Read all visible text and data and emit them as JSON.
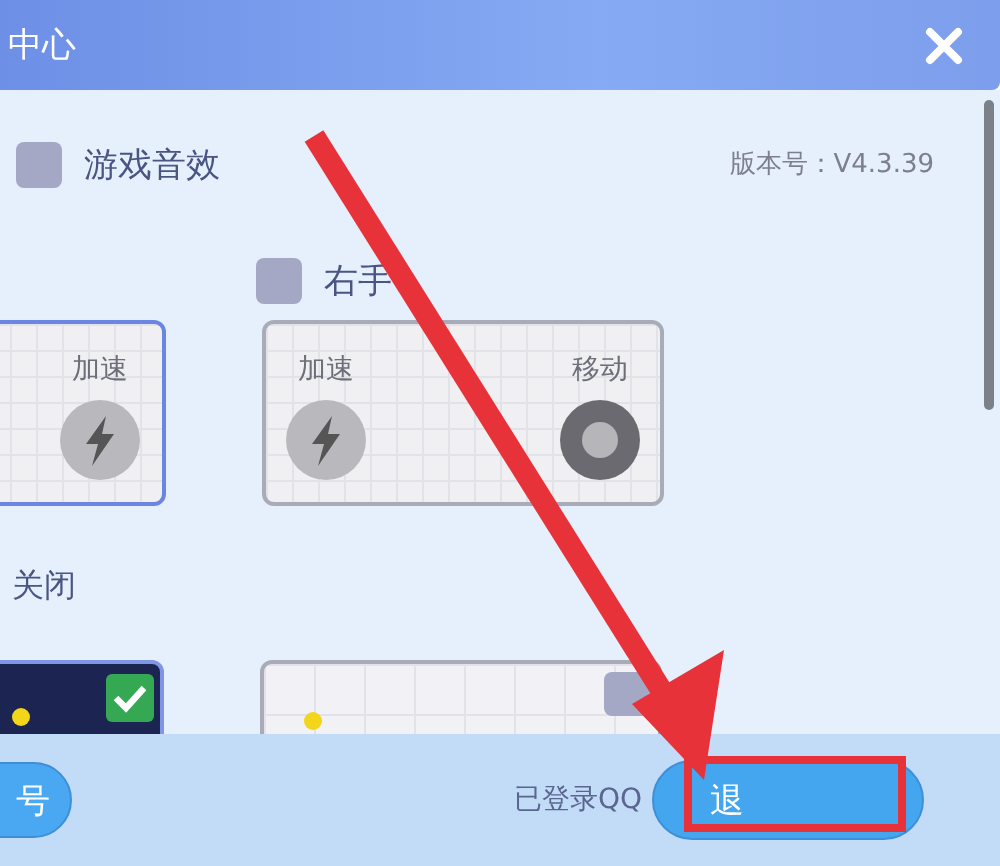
{
  "window": {
    "title": "中心"
  },
  "sound": {
    "label": "游戏音效",
    "checked": false
  },
  "version": "版本号：V4.3.39",
  "right_hand": {
    "label": "右手",
    "checked": false
  },
  "layouts": [
    {
      "selected": true,
      "controls": [
        {
          "kind": "boost",
          "label": "加速"
        }
      ]
    },
    {
      "selected": false,
      "controls": [
        {
          "kind": "boost",
          "label": "加速"
        },
        {
          "kind": "joystick",
          "label": "移动"
        }
      ]
    }
  ],
  "section_label": "关闭",
  "themes": [
    {
      "kind": "dark",
      "selected": true
    },
    {
      "kind": "light",
      "selected": false
    }
  ],
  "footer": {
    "left_button": "号",
    "status": "已登录QQ",
    "right_button": "退"
  },
  "annotation": {
    "arrow": true,
    "highlight": true
  }
}
